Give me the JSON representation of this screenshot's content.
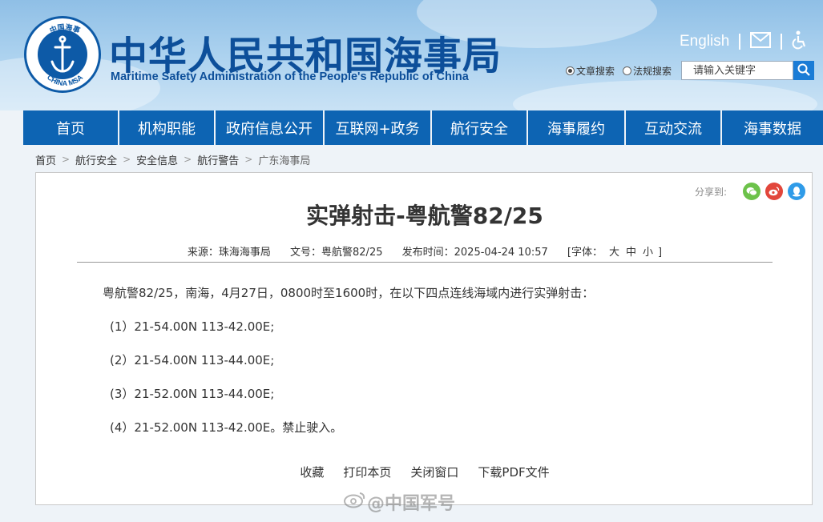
{
  "header": {
    "title_cn": "中华人民共和国海事局",
    "title_en": "Maritime Safety Administration of the People's Republic of China",
    "logo": {
      "top_text": "中国海事",
      "bottom_text": "CHINA MSA"
    },
    "english_link": "English",
    "mail_icon": "envelope-icon",
    "accessibility_icon": "wheelchair-icon",
    "search": {
      "radio_article": "文章搜索",
      "radio_regulation": "法规搜索",
      "placeholder": "请输入关键字",
      "button_icon": "search-icon"
    }
  },
  "nav": {
    "items": [
      "首页",
      "机构职能",
      "政府信息公开",
      "互联网+政务",
      "航行安全",
      "海事履约",
      "互动交流",
      "海事数据"
    ]
  },
  "breadcrumb": [
    "首页",
    "航行安全",
    "安全信息",
    "航行警告",
    "广东海事局"
  ],
  "article": {
    "share_label": "分享到:",
    "share_icons": [
      "wechat-icon",
      "weibo-icon",
      "qq-icon"
    ],
    "title": "实弹射击-粤航警82/25",
    "meta": {
      "source": "来源：珠海海事局",
      "doc_no": "文号：粤航警82/25",
      "published": "发布时间：2025-04-24 10:57",
      "font_label": "[字体：",
      "font_large": "大",
      "font_medium": "中",
      "font_small": "小",
      "font_end": "]"
    },
    "paragraphs": [
      "粤航警82/25，南海，4月27日，0800时至1600时，在以下四点连线海域内进行实弹射击：",
      "(1）21-54.00N 113-42.00E;",
      "(2）21-54.00N 113-44.00E;",
      "(3）21-52.00N 113-44.00E;",
      "(4）21-52.00N 113-42.00E。禁止驶入。"
    ],
    "actions": [
      "收藏",
      "打印本页",
      "关闭窗口",
      "下载PDF文件"
    ]
  },
  "watermark": "@中国军号",
  "colors": {
    "brand_blue": "#0d4f9a",
    "nav_blue": "#0d64b3",
    "wechat_green": "#6cc24a",
    "weibo_red": "#e2463b",
    "qq_blue": "#2f9be8"
  }
}
